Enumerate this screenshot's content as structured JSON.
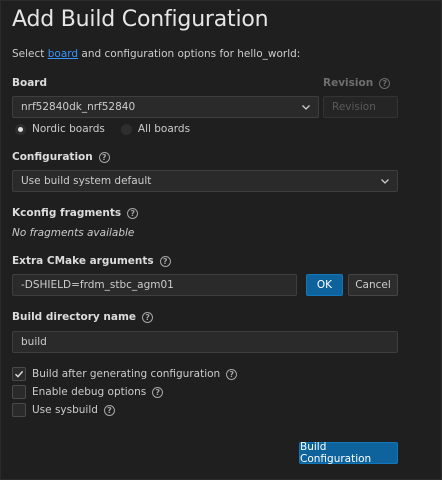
{
  "title": "Add Build Configuration",
  "subtitle": {
    "prefix": "Select ",
    "link": "board",
    "suffix": " and configuration options for hello_world:"
  },
  "board": {
    "label": "Board",
    "value": "nrf52840dk_nrf52840",
    "options": [
      "Nordic boards",
      "All boards"
    ],
    "selected_option": "Nordic boards"
  },
  "revision": {
    "label": "Revision",
    "placeholder": "Revision"
  },
  "configuration": {
    "label": "Configuration",
    "value": "Use build system default"
  },
  "kconfig": {
    "label": "Kconfig fragments",
    "empty_text": "No fragments available"
  },
  "cmake": {
    "label": "Extra CMake arguments",
    "value": "-DSHIELD=frdm_stbc_agm01",
    "ok_label": "OK",
    "cancel_label": "Cancel"
  },
  "build_dir": {
    "label": "Build directory name",
    "value": "build"
  },
  "checkboxes": [
    {
      "label": "Build after generating configuration",
      "checked": true
    },
    {
      "label": "Enable debug options",
      "checked": false
    },
    {
      "label": "Use sysbuild",
      "checked": false
    }
  ],
  "submit_label": "Build Configuration",
  "help_glyph": "?",
  "check_glyph": "✓",
  "colors": {
    "background": "#1f1f1f",
    "link": "#3794ff",
    "primary_button": "#0e639c"
  }
}
